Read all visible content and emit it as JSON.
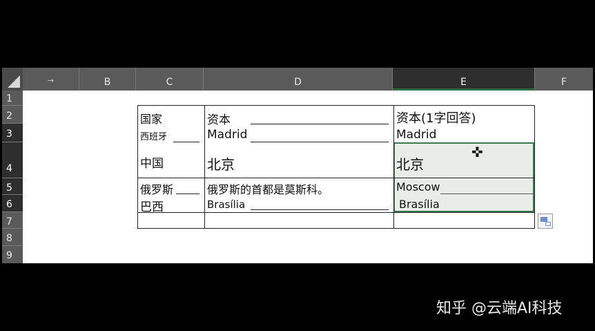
{
  "columns": [
    {
      "id": "A",
      "label": "→"
    },
    {
      "id": "B",
      "label": "B"
    },
    {
      "id": "C",
      "label": "C"
    },
    {
      "id": "D",
      "label": "D"
    },
    {
      "id": "E",
      "label": "E"
    },
    {
      "id": "F",
      "label": "F"
    }
  ],
  "rows": [
    "1",
    "2",
    "3",
    "4",
    "5",
    "6",
    "7",
    "8",
    "9"
  ],
  "table": {
    "header": {
      "c": "国家",
      "d": "资本",
      "e": "资本(1字回答)"
    },
    "rows": [
      {
        "c": "西班牙",
        "d": "Madrid",
        "e": "Madrid"
      },
      {
        "c": "中国",
        "d": "北京",
        "e": "北京"
      },
      {
        "c": "俄罗斯",
        "d": "俄罗斯的首都是莫斯科。",
        "e": "Moscow"
      },
      {
        "c": "巴西",
        "d": "Brasília",
        "e": "Brasília"
      }
    ]
  },
  "selected_column": "E",
  "colors": {
    "selection": "#3a7a4e",
    "header_bg": "#5a5a5a"
  },
  "watermark": {
    "text": "知乎 @云端AI科技"
  }
}
